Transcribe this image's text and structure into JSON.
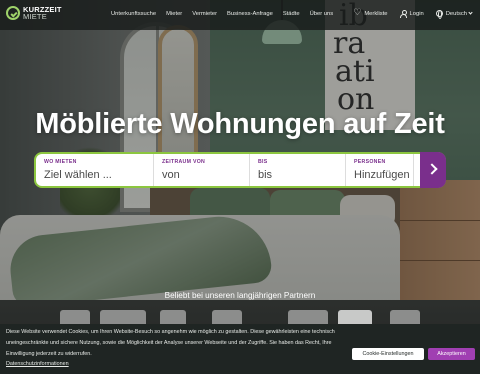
{
  "brand": {
    "line1": "KURZZEIT",
    "line2": "MIETE"
  },
  "nav": {
    "links": [
      "Unterkunftssuche",
      "Mieter",
      "Vermieter",
      "Business-Anfrage",
      "Städte",
      "Über uns"
    ],
    "merkliste": "Merkliste",
    "login": "Login",
    "language": "Deutsch"
  },
  "hero": {
    "title": "Möblierte Wohnungen auf Zeit"
  },
  "search": {
    "where_label": "WO MIETEN",
    "where_value": "Ziel wählen ...",
    "from_label": "ZEITRAUM VON",
    "from_value": "von",
    "to_label": "BIS",
    "to_value": "bis",
    "persons_label": "PERSONEN",
    "persons_value": "Hinzufügen"
  },
  "partners": {
    "title": "Beliebt bei unseren langjährigen Partnern"
  },
  "cookie": {
    "text": "Diese Website verwendet Cookies, um Ihren Website-Besuch so angenehm wie möglich zu gestalten. Diese gewährleisten eine technisch uneingeschränkte und sichere Nutzung, sowie die Möglichkeit der Analyse unserer Webseite und der Zugriffe. Sie haben das Recht, Ihre Einwilligung jederzeit zu widerrufen.",
    "privacy_link": "Datenschutzinformationen",
    "settings_button": "Cookie-Einstellungen",
    "accept_button": "Akzeptieren"
  },
  "colors": {
    "accent_purple": "#7a2f8c",
    "accent_green": "#8cc63f"
  }
}
